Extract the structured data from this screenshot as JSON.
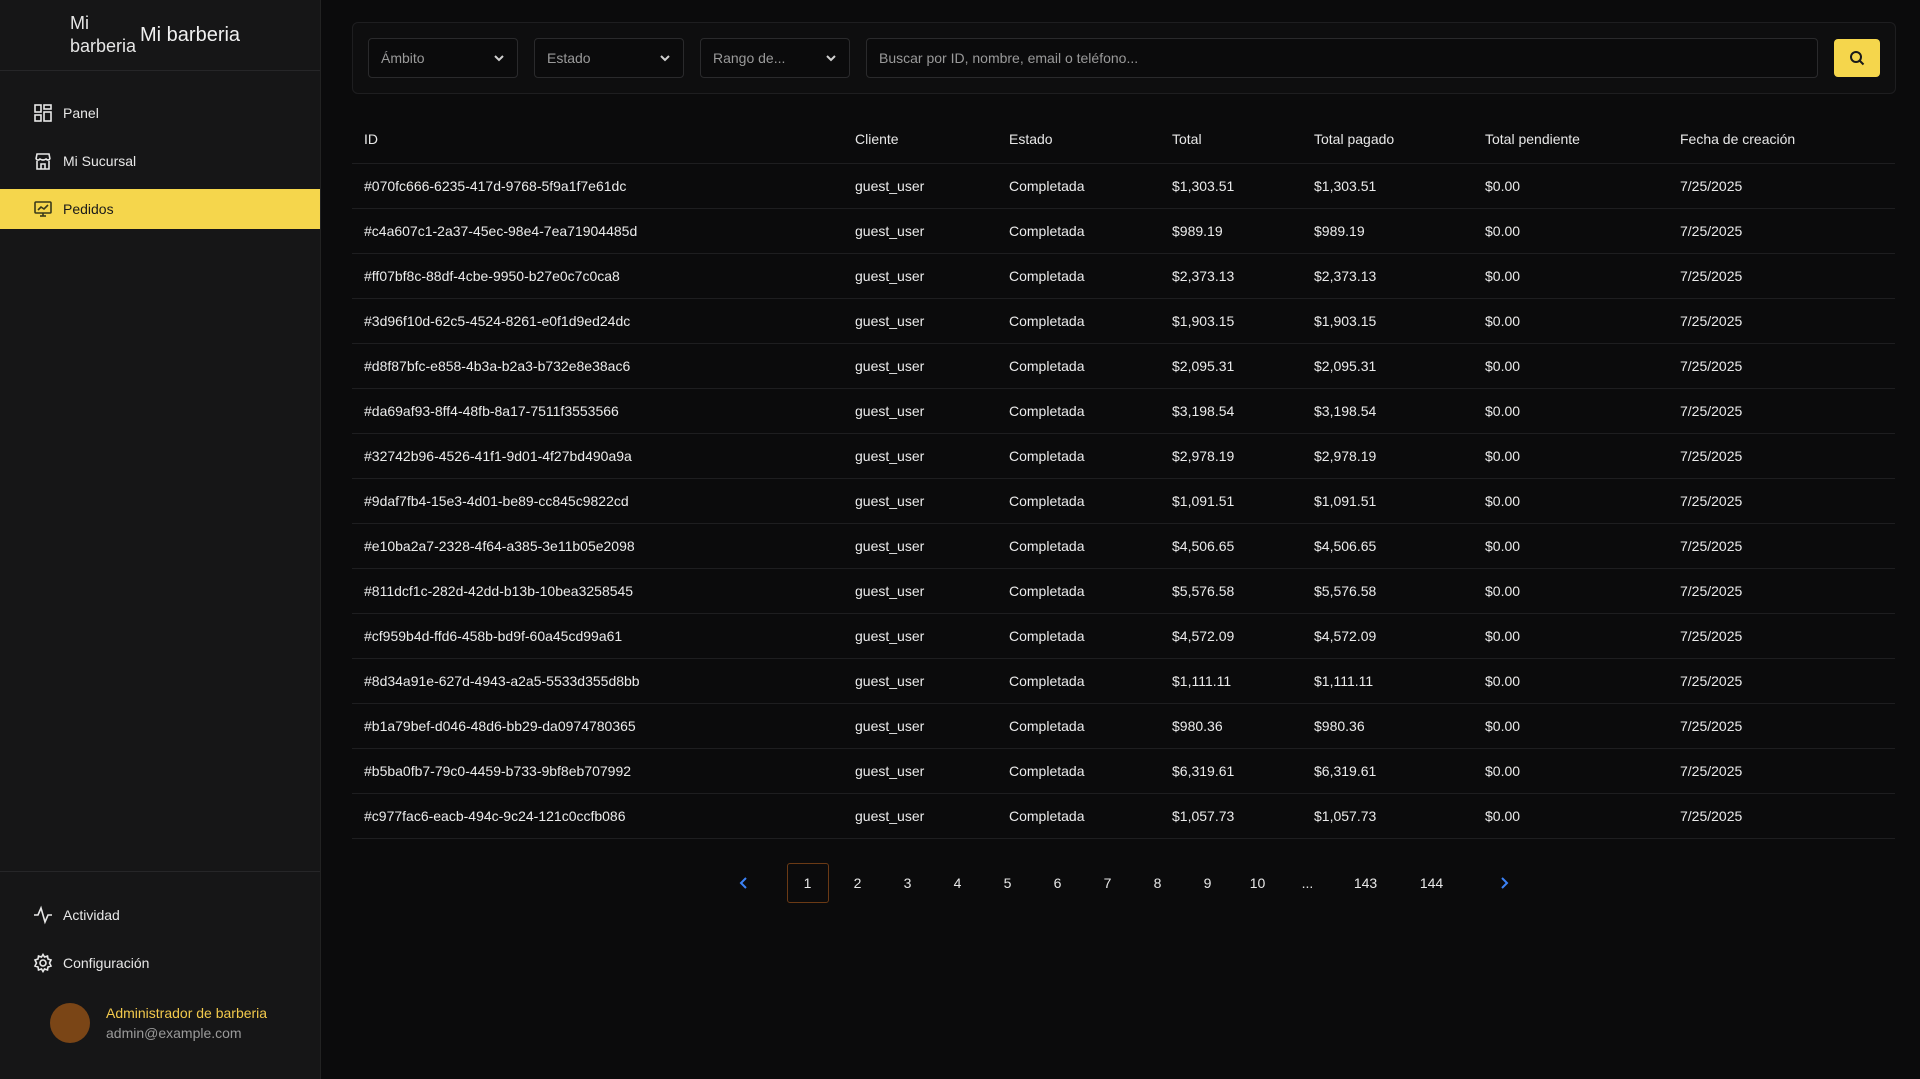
{
  "app": {
    "logo_alt": "Mi barberia",
    "title": "Mi barberia"
  },
  "sidebar": {
    "items": [
      {
        "label": "Panel",
        "icon": "grid-icon"
      },
      {
        "label": "Mi Sucursal",
        "icon": "store-icon"
      },
      {
        "label": "Pedidos",
        "icon": "orders-icon",
        "active": true
      }
    ],
    "bottom_items": [
      {
        "label": "Actividad",
        "icon": "activity-icon"
      },
      {
        "label": "Configuración",
        "icon": "gear-icon"
      }
    ],
    "user": {
      "name": "Administrador de barberia",
      "email": "admin@example.com"
    }
  },
  "filters": {
    "scope": "Ámbito",
    "status": "Estado",
    "range": "Rango de...",
    "search_placeholder": "Buscar por ID, nombre, email o teléfono..."
  },
  "table": {
    "headers": [
      "ID",
      "Cliente",
      "Estado",
      "Total",
      "Total pagado",
      "Total pendiente",
      "Fecha de creación"
    ],
    "rows": [
      [
        "#070fc666-6235-417d-9768-5f9a1f7e61dc",
        "guest_user",
        "Completada",
        "$1,303.51",
        "$1,303.51",
        "$0.00",
        "7/25/2025"
      ],
      [
        "#c4a607c1-2a37-45ec-98e4-7ea71904485d",
        "guest_user",
        "Completada",
        "$989.19",
        "$989.19",
        "$0.00",
        "7/25/2025"
      ],
      [
        "#ff07bf8c-88df-4cbe-9950-b27e0c7c0ca8",
        "guest_user",
        "Completada",
        "$2,373.13",
        "$2,373.13",
        "$0.00",
        "7/25/2025"
      ],
      [
        "#3d96f10d-62c5-4524-8261-e0f1d9ed24dc",
        "guest_user",
        "Completada",
        "$1,903.15",
        "$1,903.15",
        "$0.00",
        "7/25/2025"
      ],
      [
        "#d8f87bfc-e858-4b3a-b2a3-b732e8e38ac6",
        "guest_user",
        "Completada",
        "$2,095.31",
        "$2,095.31",
        "$0.00",
        "7/25/2025"
      ],
      [
        "#da69af93-8ff4-48fb-8a17-7511f3553566",
        "guest_user",
        "Completada",
        "$3,198.54",
        "$3,198.54",
        "$0.00",
        "7/25/2025"
      ],
      [
        "#32742b96-4526-41f1-9d01-4f27bd490a9a",
        "guest_user",
        "Completada",
        "$2,978.19",
        "$2,978.19",
        "$0.00",
        "7/25/2025"
      ],
      [
        "#9daf7fb4-15e3-4d01-be89-cc845c9822cd",
        "guest_user",
        "Completada",
        "$1,091.51",
        "$1,091.51",
        "$0.00",
        "7/25/2025"
      ],
      [
        "#e10ba2a7-2328-4f64-a385-3e11b05e2098",
        "guest_user",
        "Completada",
        "$4,506.65",
        "$4,506.65",
        "$0.00",
        "7/25/2025"
      ],
      [
        "#811dcf1c-282d-42dd-b13b-10bea3258545",
        "guest_user",
        "Completada",
        "$5,576.58",
        "$5,576.58",
        "$0.00",
        "7/25/2025"
      ],
      [
        "#cf959b4d-ffd6-458b-bd9f-60a45cd99a61",
        "guest_user",
        "Completada",
        "$4,572.09",
        "$4,572.09",
        "$0.00",
        "7/25/2025"
      ],
      [
        "#8d34a91e-627d-4943-a2a5-5533d355d8bb",
        "guest_user",
        "Completada",
        "$1,111.11",
        "$1,111.11",
        "$0.00",
        "7/25/2025"
      ],
      [
        "#b1a79bef-d046-48d6-bb29-da0974780365",
        "guest_user",
        "Completada",
        "$980.36",
        "$980.36",
        "$0.00",
        "7/25/2025"
      ],
      [
        "#b5ba0fb7-79c0-4459-b733-9bf8eb707992",
        "guest_user",
        "Completada",
        "$6,319.61",
        "$6,319.61",
        "$0.00",
        "7/25/2025"
      ],
      [
        "#c977fac6-eacb-494c-9c24-121c0ccfb086",
        "guest_user",
        "Completada",
        "$1,057.73",
        "$1,057.73",
        "$0.00",
        "7/25/2025"
      ]
    ]
  },
  "pagination": {
    "pages": [
      "1",
      "2",
      "3",
      "4",
      "5",
      "6",
      "7",
      "8",
      "9",
      "10",
      "...",
      "143",
      "144"
    ],
    "current": "1"
  },
  "colors": {
    "accent": "#f5d64c",
    "user_name": "#f2c94c",
    "avatar": "#7a4516",
    "pagination_arrow": "#3b82f6",
    "background": "#0b0b0c",
    "sidebar": "#161617"
  }
}
